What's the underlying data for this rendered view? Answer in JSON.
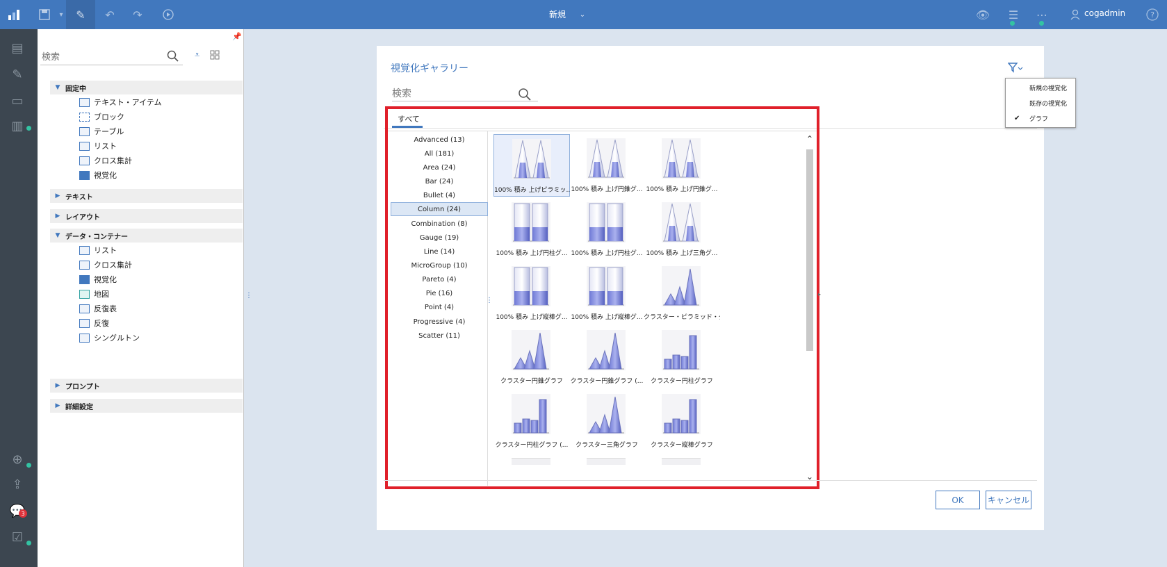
{
  "topbar": {
    "title": "新規",
    "user": "cogadmin"
  },
  "rail": {
    "comment_count": "3"
  },
  "panel": {
    "search_placeholder": "検索",
    "sections": {
      "pinned": "固定中",
      "text": "テキスト",
      "layout": "レイアウト",
      "data_container": "データ・コンテナー",
      "prompt": "プロンプト",
      "advanced": "詳細設定"
    },
    "pinned_items": [
      "テキスト・アイテム",
      "ブロック",
      "テーブル",
      "リスト",
      "クロス集計",
      "視覚化"
    ],
    "container_items": [
      "リスト",
      "クロス集計",
      "視覚化",
      "地図",
      "反復表",
      "反復",
      "シングルトン"
    ]
  },
  "gallery": {
    "title": "視覚化ギャラリー",
    "search_placeholder": "検索",
    "tab": "すべて",
    "categories": [
      "Advanced (13)",
      "All (181)",
      "Area (24)",
      "Bar (24)",
      "Bullet (4)",
      "Column (24)",
      "Combination (8)",
      "Gauge (19)",
      "Line (14)",
      "MicroGroup (10)",
      "Pareto (4)",
      "Pie (16)",
      "Point (4)",
      "Progressive (4)",
      "Scatter (11)"
    ],
    "selected_category": "Column (24)",
    "thumbnails": [
      "100% 積み 上げピラミッ...",
      "100% 積み 上げ円錐グ...",
      "100% 積み 上げ円錐グ...",
      "100% 積み 上げ円柱グ...",
      "100% 積み 上げ円柱グ...",
      "100% 積み 上げ三角グ...",
      "100% 積み 上げ縦棒グ...",
      "100% 積み 上げ縦棒グ...",
      "クラスター・ピラミッド・グ...",
      "クラスター円錐グラフ",
      "クラスター円錐グラフ (...",
      "クラスター円柱グラフ",
      "クラスター円柱グラフ (...",
      "クラスター三角グラフ",
      "クラスター縦棒グラフ"
    ],
    "ok_label": "OK",
    "cancel_label": "キャンセル"
  },
  "filter_menu": {
    "items": [
      "新規の視覚化",
      "既存の視覚化",
      "グラフ"
    ],
    "checked_item": "グラフ"
  },
  "colors": {
    "brand": "#4178be",
    "rail": "#3c4650",
    "highlight": "#e0202a"
  }
}
